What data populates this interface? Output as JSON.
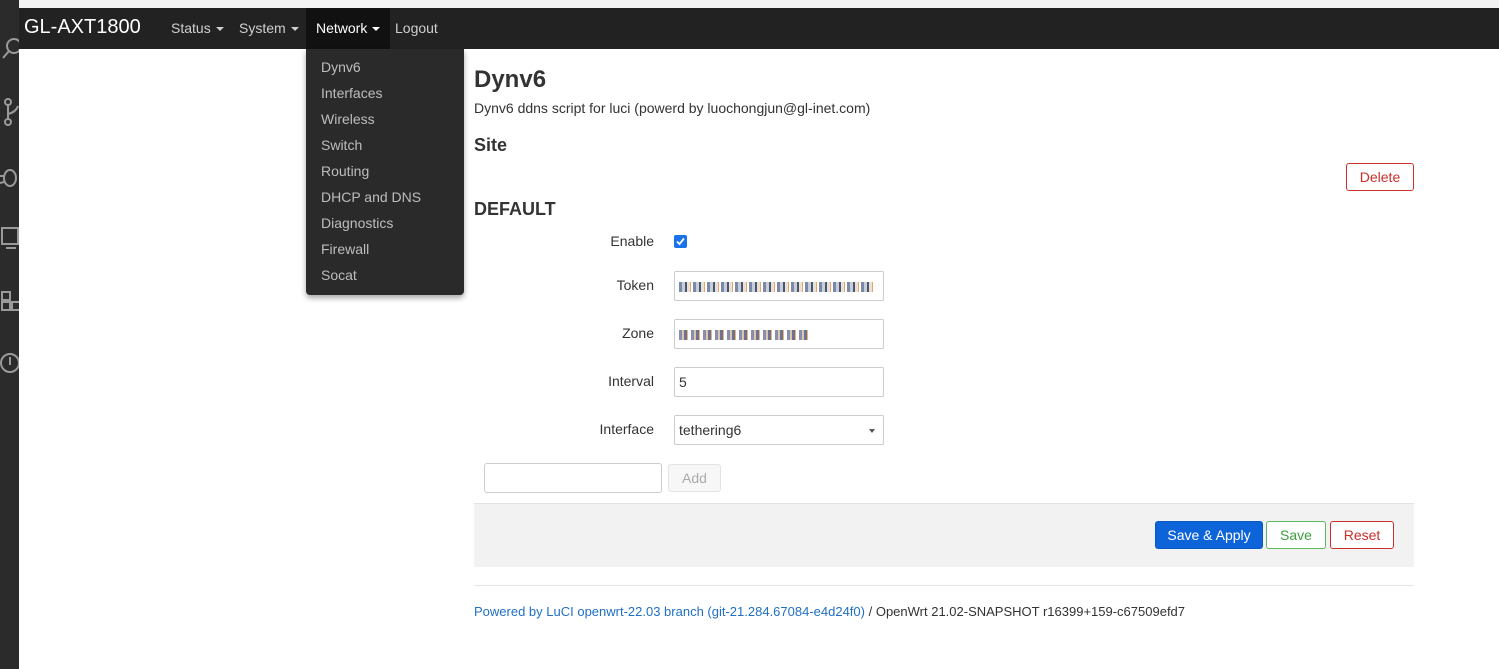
{
  "navbar": {
    "brand": "GL-AXT1800",
    "menus": [
      {
        "label": "Status"
      },
      {
        "label": "System"
      },
      {
        "label": "Network"
      },
      {
        "label": "Logout"
      }
    ]
  },
  "network_menu": {
    "items": [
      "Dynv6",
      "Interfaces",
      "Wireless",
      "Switch",
      "Routing",
      "DHCP and DNS",
      "Diagnostics",
      "Firewall",
      "Socat"
    ]
  },
  "page": {
    "title": "Dynv6",
    "description": "Dynv6 ddns script for luci (powerd by luochongjun@gl-inet.com)",
    "section_title": "Site",
    "delete_label": "Delete",
    "subsection_title": "DEFAULT"
  },
  "form": {
    "enable_label": "Enable",
    "enable_checked": true,
    "token_label": "Token",
    "token_value": "",
    "zone_label": "Zone",
    "zone_value": "",
    "interval_label": "Interval",
    "interval_value": "5",
    "interface_label": "Interface",
    "interface_value": "tethering6",
    "add_label": "Add"
  },
  "actions": {
    "save_apply": "Save & Apply",
    "save": "Save",
    "reset": "Reset"
  },
  "footer": {
    "luci_link": "Powered by LuCI openwrt-22.03 branch (git-21.284.67084-e4d24f0)",
    "separator": " / ",
    "version": "OpenWrt 21.02-SNAPSHOT r16399+159-c67509efd7"
  },
  "colors": {
    "navbar_bg": "#222222",
    "primary": "#0d64d8",
    "danger": "#c9302c",
    "success": "#5cb85c",
    "link": "#1f6fc5"
  },
  "icons": [
    "search-icon",
    "source-control-icon",
    "debug-icon",
    "remote-explorer-icon",
    "extensions-icon",
    "timeline-icon"
  ]
}
